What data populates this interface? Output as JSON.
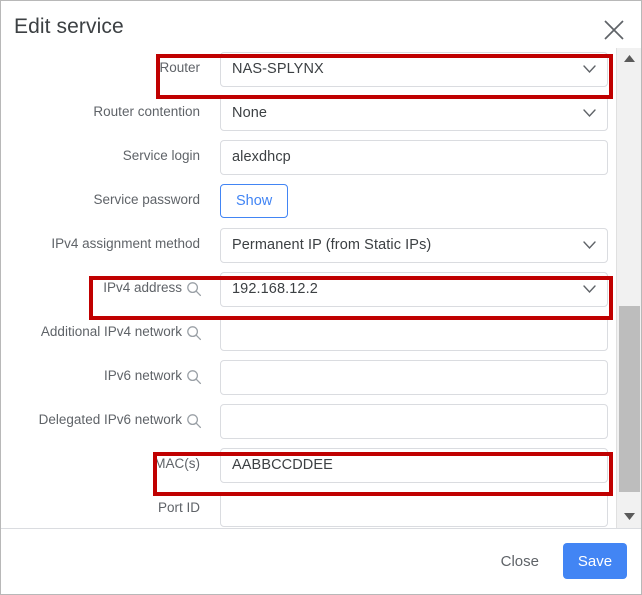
{
  "dialog": {
    "title": "Edit service",
    "close_icon": "close-icon"
  },
  "form": {
    "rows": [
      {
        "label": "Router",
        "type": "select",
        "value": "NAS-SPLYNX",
        "search_icon": false,
        "highlighted": true
      },
      {
        "label": "Router contention",
        "type": "select",
        "value": "None",
        "search_icon": false,
        "highlighted": false
      },
      {
        "label": "Service login",
        "type": "text",
        "value": "alexdhcp",
        "search_icon": false,
        "highlighted": false
      },
      {
        "label": "Service password",
        "type": "button",
        "value": "Show",
        "search_icon": false,
        "highlighted": false
      },
      {
        "label": "IPv4 assignment method",
        "type": "select",
        "value": "Permanent IP (from Static IPs)",
        "search_icon": false,
        "highlighted": false
      },
      {
        "label": "IPv4 address",
        "type": "select",
        "value": "192.168.12.2",
        "search_icon": true,
        "highlighted": true
      },
      {
        "label": "Additional IPv4 network",
        "type": "text",
        "value": "",
        "search_icon": true,
        "highlighted": false
      },
      {
        "label": "IPv6 network",
        "type": "text",
        "value": "",
        "search_icon": true,
        "highlighted": false
      },
      {
        "label": "Delegated IPv6 network",
        "type": "text",
        "value": "",
        "search_icon": true,
        "highlighted": false
      },
      {
        "label": "MAC(s)",
        "type": "text",
        "value": "AABBCCDDEE",
        "search_icon": false,
        "highlighted": true
      },
      {
        "label": "Port ID",
        "type": "text",
        "value": "",
        "search_icon": false,
        "highlighted": false
      }
    ]
  },
  "footer": {
    "close_label": "Close",
    "save_label": "Save"
  },
  "scrollbar": {
    "up_icon": "triangle-up-icon",
    "down_icon": "triangle-down-icon"
  },
  "colors": {
    "accent": "#4285f4",
    "highlight": "#c00000",
    "label": "#5f6368",
    "value": "#3c4043",
    "border": "#dadce0"
  }
}
